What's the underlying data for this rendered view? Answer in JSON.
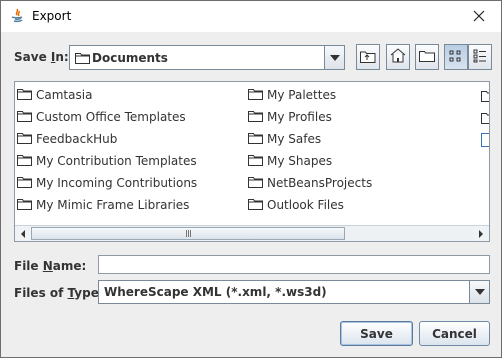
{
  "window": {
    "title": "Export"
  },
  "save_in": {
    "label_pre": "Save ",
    "label_key": "I",
    "label_post": "n:",
    "value": "Documents"
  },
  "toolbar": {
    "icons": [
      "up-folder-icon",
      "home-icon",
      "new-folder-icon",
      "list-view-icon",
      "details-view-icon"
    ]
  },
  "files": {
    "column1": [
      "Camtasia",
      "Custom Office Templates",
      "FeedbackHub",
      "My Contribution Templates",
      "My Incoming Contributions",
      "My Mimic Frame Libraries"
    ],
    "column2": [
      "My Palettes",
      "My Profiles",
      "My Safes",
      "My Shapes",
      "NetBeansProjects",
      "Outlook Files"
    ]
  },
  "file_name": {
    "label_pre": "File ",
    "label_key": "N",
    "label_post": "ame:",
    "value": ""
  },
  "files_of_type": {
    "label_pre": "Files of ",
    "label_key": "T",
    "label_post": "ype:",
    "value": "WhereScape XML (*.xml, *.ws3d)"
  },
  "buttons": {
    "save": "Save",
    "cancel": "Cancel"
  }
}
